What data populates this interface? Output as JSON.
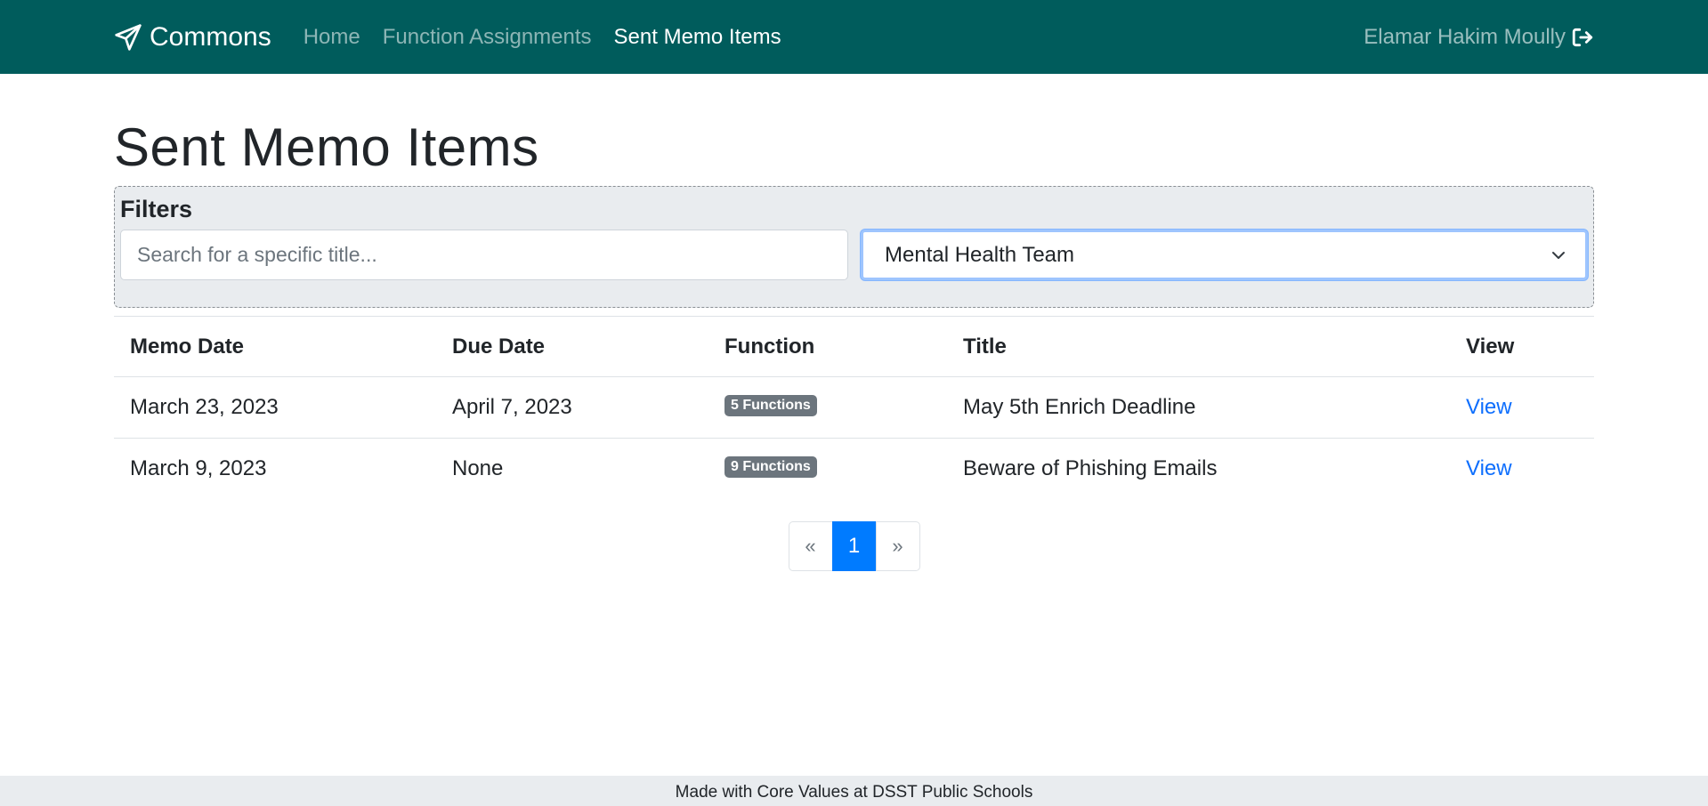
{
  "nav": {
    "brand": "Commons",
    "links": [
      {
        "label": "Home",
        "active": false
      },
      {
        "label": "Function Assignments",
        "active": false
      },
      {
        "label": "Sent Memo Items",
        "active": true
      }
    ],
    "user": "Elamar Hakim Moully"
  },
  "page": {
    "title": "Sent Memo Items"
  },
  "filters": {
    "heading": "Filters",
    "search_placeholder": "Search for a specific title...",
    "search_value": "",
    "selected_team": "Mental Health Team"
  },
  "table": {
    "headers": [
      "Memo Date",
      "Due Date",
      "Function",
      "Title",
      "View"
    ],
    "rows": [
      {
        "memo_date": "March 23, 2023",
        "due_date": "April 7, 2023",
        "function": "5 Functions",
        "title": "May 5th Enrich Deadline",
        "view": "View"
      },
      {
        "memo_date": "March 9, 2023",
        "due_date": "None",
        "function": "9 Functions",
        "title": "Beware of Phishing Emails",
        "view": "View"
      }
    ]
  },
  "pagination": {
    "prev": "«",
    "current": "1",
    "next": "»"
  },
  "footer": {
    "text": "Made with Core Values at DSST Public Schools"
  },
  "colors": {
    "navbar": "#005c5c",
    "link": "#0d6efd",
    "active_page": "#007bff",
    "badge": "#6c757d"
  }
}
